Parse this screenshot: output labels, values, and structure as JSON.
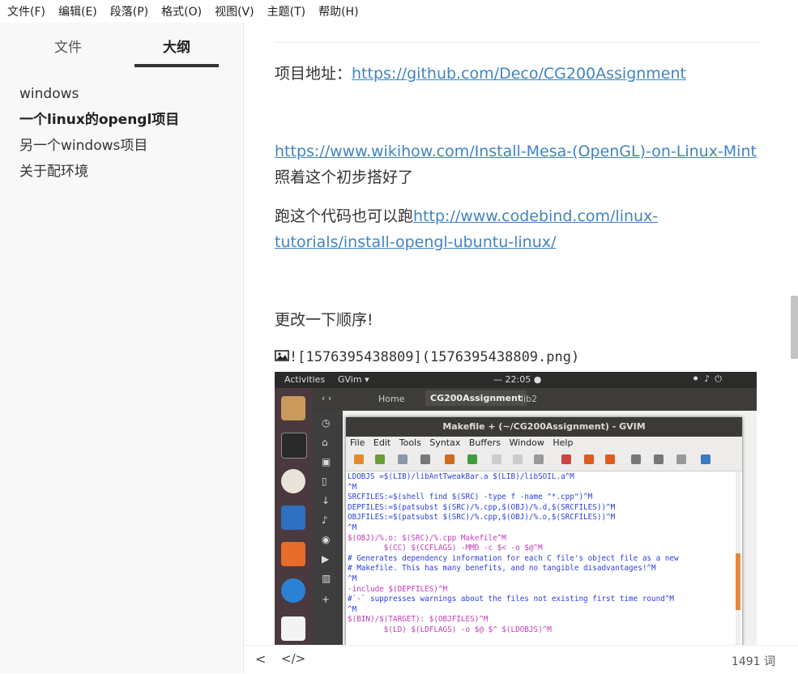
{
  "menubar": [
    "文件(F)",
    "编辑(E)",
    "段落(P)",
    "格式(O)",
    "视图(V)",
    "主题(T)",
    "帮助(H)"
  ],
  "sidebar": {
    "tabs": [
      "文件",
      "大纲"
    ],
    "outline": [
      "windows",
      "一个linux的opengl项目",
      "另一个windows项目",
      "关于配环境"
    ]
  },
  "document": {
    "title_fragment": "Linux的opengl项目",
    "p1_label": "项目地址：",
    "p1_link": "https://github.com/Deco/CG200Assignment",
    "p2_link": "https://www.wikihow.com/Install-Mesa-(OpenGL)-on-Linux-Mint",
    "p2_text": "照着这个初步搭好了",
    "p3_text": "跑这个代码也可以跑",
    "p3_link_line1": "http://www.codebind.com/linux-",
    "p3_link_line2": "tutorials/install-opengl-ubuntu-linux/",
    "p4_text": "更改一下顺序!",
    "image_markup": "![1576395438809](1576395438809.png)"
  },
  "screenshot": {
    "topbar_activities": "Activities",
    "topbar_app": "GVim ▾",
    "topbar_time": "— 22:05 ●",
    "files_home": "Home",
    "files_folder": "CG200Assignment",
    "files_folder2": "lib2",
    "gvim_title": "Makefile + (~/CG200Assignment) - GVIM",
    "gvim_menu": [
      "File",
      "Edit",
      "Tools",
      "Syntax",
      "Buffers",
      "Window",
      "Help"
    ],
    "code_lines": [
      "LDOBJS =$(LIB)/libAntTweakBar.a $(LIB)/libSOIL.a^M",
      "^M",
      "SRCFILES:=$(shell find $(SRC) -type f -name \"*.cpp\")^M",
      "DEPFILES:=$(patsubst $(SRC)/%.cpp,$(OBJ)/%.d,$(SRCFILES))^M",
      "OBJFILES:=$(patsubst $(SRC)/%.cpp,$(OBJ)/%.o,$(SRCFILES))^M",
      "^M",
      "$(OBJ)/%.o: $(SRC)/%.cpp Makefile^M",
      "        $(CC) $(CCFLAGS) -MMD -c $< -o $@^M",
      "# Generates dependency information for each C file's object file as a new",
      "# Makefile. This has many benefits, and no tangible disadvantages!^M",
      "^M",
      "-include $(DEPFILES)^M",
      "#`-` suppresses warnings about the files not existing first time round^M",
      "^M",
      "$(BIN)/$(TARGET): $(OBJFILES)^M",
      "        $(LD) $(LDFLAGS) -o $@ $^ $(LDOBJS)^M"
    ]
  },
  "footer": {
    "back": "<",
    "code_toggle": "</>",
    "word_count": "1491 词"
  },
  "colors": {
    "link": "#4183c4",
    "sidebar_bg": "#f8f8f8",
    "tab_underline": "#333333"
  }
}
